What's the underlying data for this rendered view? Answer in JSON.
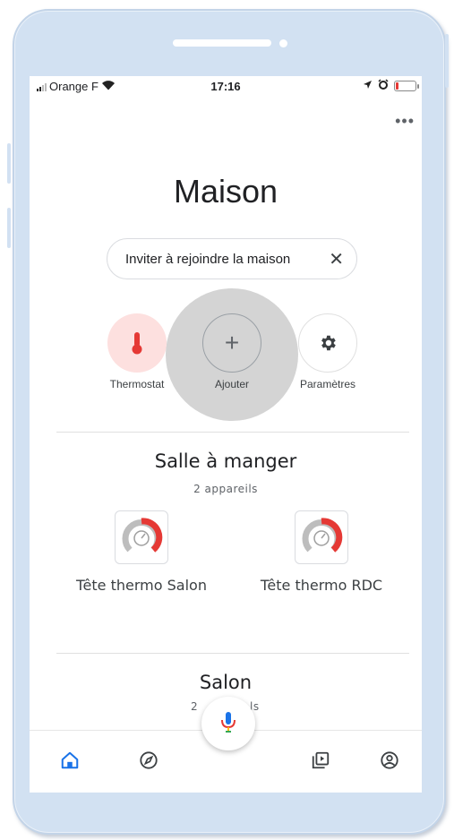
{
  "status_bar": {
    "carrier": "Orange F",
    "time": "17:16",
    "battery_level": 0.15
  },
  "header": {
    "more_label": "•••",
    "title": "Maison"
  },
  "invite_chip": {
    "label": "Inviter à rejoindre la maison",
    "close": "✕"
  },
  "actions": [
    {
      "label": "Thermostat",
      "icon": "thermometer-icon"
    },
    {
      "label": "Ajouter",
      "icon": "plus-icon",
      "glyph": "+"
    },
    {
      "label": "Paramètres",
      "icon": "gear-icon"
    }
  ],
  "rooms": [
    {
      "name": "Salle à manger",
      "count": "2 appareils",
      "devices": [
        {
          "name": "Tête thermo Salon",
          "icon": "gauge-icon"
        },
        {
          "name": "Tête thermo RDC",
          "icon": "gauge-icon"
        }
      ]
    },
    {
      "name": "Salon",
      "count_partial_left": "2",
      "count_partial_right": "ls"
    }
  ],
  "bottom_nav": [
    "home-icon",
    "explore-icon",
    "media-icon",
    "account-icon"
  ],
  "colors": {
    "accent_blue": "#1a73e8",
    "thermo_red": "#e53935",
    "thermo_bg": "#fde0df",
    "frame": "#d2e1f2"
  }
}
